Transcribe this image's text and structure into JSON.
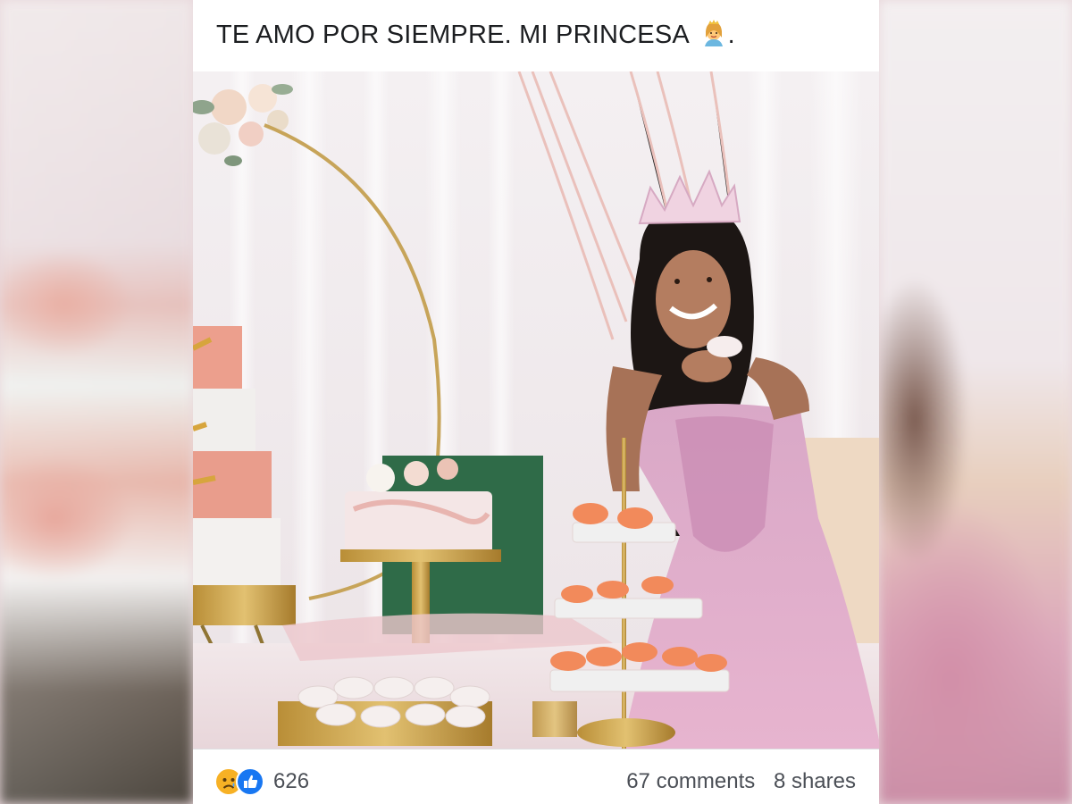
{
  "post": {
    "caption": "TE AMO POR SIEMPRE.  MI PRINCESA",
    "caption_end": ".",
    "caption_emoji": "princess-emoji",
    "photo_description_icon": "photo"
  },
  "footer": {
    "reactions": [
      "sad-reaction-icon",
      "like-reaction-icon"
    ],
    "reaction_count": "626",
    "comments": "67 comments",
    "shares": "8 shares"
  },
  "colors": {
    "like_blue": "#1877f2",
    "sad_yellow": "#f7b125",
    "text_primary": "#1c1e21",
    "text_secondary": "#4b4f56"
  }
}
